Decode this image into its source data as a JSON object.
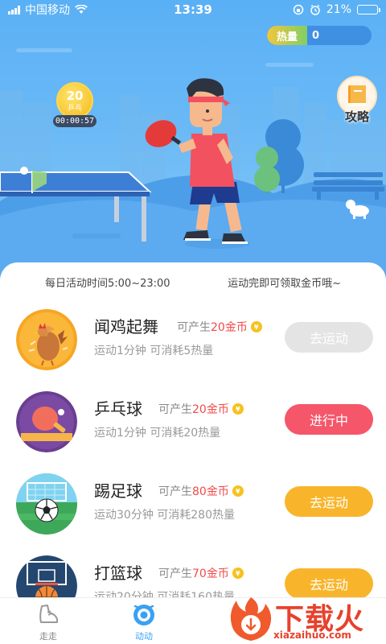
{
  "status_bar": {
    "carrier": "中国移动",
    "time": "13:39",
    "battery": "21%",
    "battery_level": 0.21
  },
  "heat": {
    "label": "热量",
    "value": "0"
  },
  "coin": {
    "value": "20",
    "label": "乒乓",
    "timer": "00:00:57"
  },
  "strategy": {
    "label": "攻略"
  },
  "info": {
    "left": "每日活动时间5:00~23:00",
    "right": "运动完即可领取金币哦~"
  },
  "activities": [
    {
      "name": "闻鸡起舞",
      "yield_prefix": "可产生",
      "yield_amount": "20金币",
      "desc": "运动1分钟 可消耗5热量",
      "button": "去运动",
      "state": "disabled"
    },
    {
      "name": "乒乓球",
      "yield_prefix": "可产生",
      "yield_amount": "20金币",
      "desc": "运动1分钟 可消耗20热量",
      "button": "进行中",
      "state": "active"
    },
    {
      "name": "踢足球",
      "yield_prefix": "可产生",
      "yield_amount": "80金币",
      "desc": "运动30分钟 可消耗280热量",
      "button": "去运动",
      "state": "available"
    },
    {
      "name": "打篮球",
      "yield_prefix": "可产生",
      "yield_amount": "70金币",
      "desc": "运动20分钟 可消耗160热量",
      "button": "去运动",
      "state": "available"
    }
  ],
  "tabs": [
    {
      "label": "走走",
      "icon": "shoe-icon"
    },
    {
      "label": "动动",
      "icon": "activity-icon",
      "active": true
    }
  ],
  "watermark": {
    "title": "下载火",
    "url": "xiazaihuo.com"
  },
  "colors": {
    "accent": "#3aa1f2",
    "active_button": "#f5566a",
    "available_button": "#f8b52b",
    "disabled_button": "#e4e4e4",
    "coin": "#f6c21f"
  }
}
